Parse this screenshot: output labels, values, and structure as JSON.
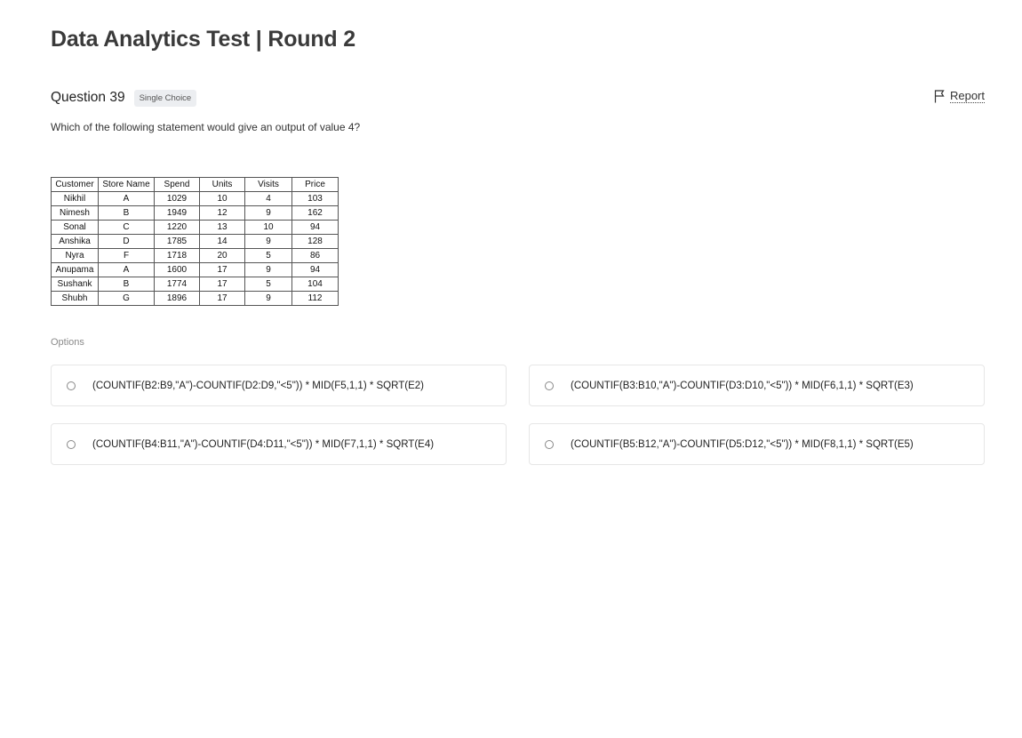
{
  "test": {
    "title": "Data Analytics Test | Round 2"
  },
  "question": {
    "number_label": "Question 39",
    "type_badge": "Single Choice",
    "report_label": "Report",
    "text": "Which of the following statement would give an output of value 4?"
  },
  "table": {
    "headers": [
      "Customer",
      "Store Name",
      "Spend",
      "Units",
      "Visits",
      "Price"
    ],
    "rows": [
      [
        "Nikhil",
        "A",
        "1029",
        "10",
        "4",
        "103"
      ],
      [
        "Nimesh",
        "B",
        "1949",
        "12",
        "9",
        "162"
      ],
      [
        "Sonal",
        "C",
        "1220",
        "13",
        "10",
        "94"
      ],
      [
        "Anshika",
        "D",
        "1785",
        "14",
        "9",
        "128"
      ],
      [
        "Nyra",
        "F",
        "1718",
        "20",
        "5",
        "86"
      ],
      [
        "Anupama",
        "A",
        "1600",
        "17",
        "9",
        "94"
      ],
      [
        "Sushank",
        "B",
        "1774",
        "17",
        "5",
        "104"
      ],
      [
        "Shubh",
        "G",
        "1896",
        "17",
        "9",
        "112"
      ]
    ]
  },
  "options": {
    "label": "Options",
    "items": [
      {
        "text": "(COUNTIF(B2:B9,\"A\")-COUNTIF(D2:D9,\"<5\")) * MID(F5,1,1) * SQRT(E2)"
      },
      {
        "text": "(COUNTIF(B3:B10,\"A\")-COUNTIF(D3:D10,\"<5\")) * MID(F6,1,1) * SQRT(E3)"
      },
      {
        "text": "(COUNTIF(B4:B11,\"A\")-COUNTIF(D4:D11,\"<5\")) * MID(F7,1,1) * SQRT(E4)"
      },
      {
        "text": "(COUNTIF(B5:B12,\"A\")-COUNTIF(D5:D12,\"<5\")) * MID(F8,1,1) * SQRT(E5)"
      }
    ]
  }
}
